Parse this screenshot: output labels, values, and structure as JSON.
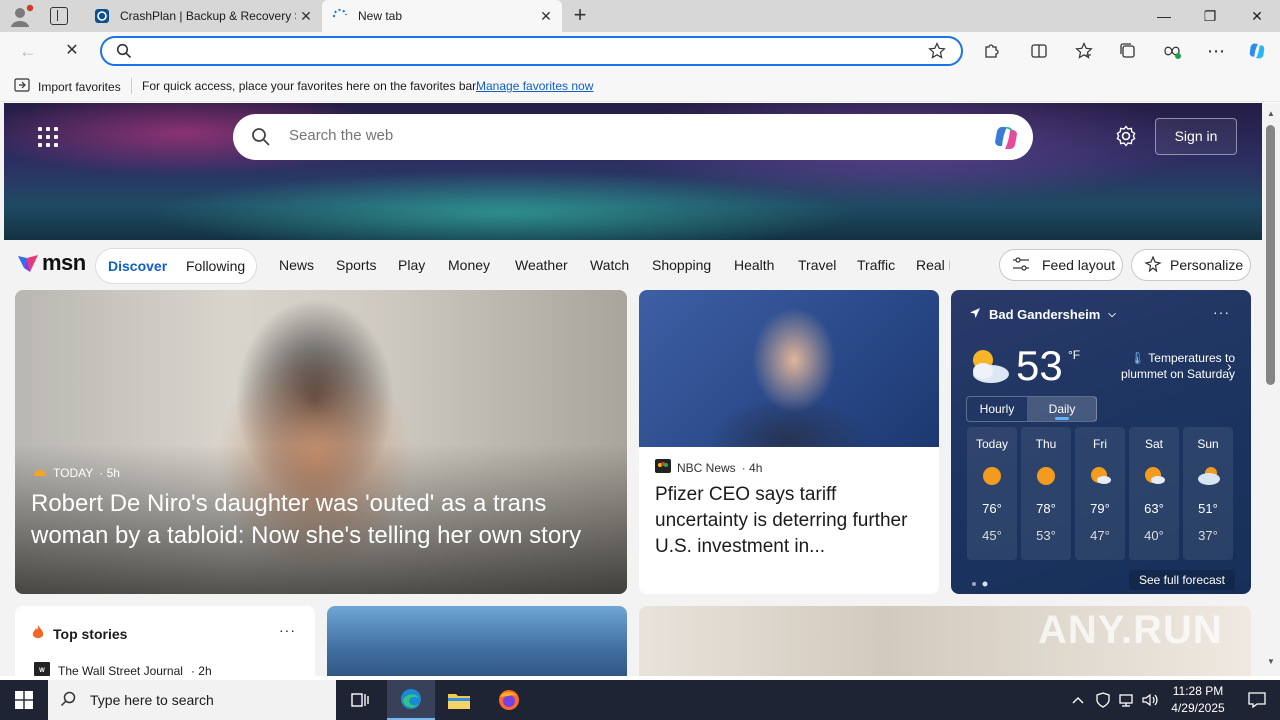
{
  "browser": {
    "tabs": [
      {
        "title": "CrashPlan | Backup & Recovery S",
        "active": false
      },
      {
        "title": "New tab",
        "active": true
      }
    ],
    "address_bar": {
      "value": "",
      "placeholder": ""
    },
    "favorites_bar": {
      "import_label": "Import favorites",
      "hint": "For quick access, place your favorites here on the favorites bar.",
      "manage_link": "Manage favorites now"
    }
  },
  "msn": {
    "search_placeholder": "Search the web",
    "sign_in": "Sign in",
    "logo_text": "msn",
    "pill": {
      "discover": "Discover",
      "following": "Following"
    },
    "nav": [
      "News",
      "Sports",
      "Play",
      "Money",
      "Weather",
      "Watch",
      "Shopping",
      "Health",
      "Travel",
      "Traffic",
      "Real E"
    ],
    "feed_layout": "Feed layout",
    "personalize": "Personalize"
  },
  "feature_story": {
    "source": "TODAY",
    "age": "· 5h",
    "headline": "Robert De Niro's daughter was 'outed' as a trans woman by a tabloid: Now she's telling her own story"
  },
  "story2": {
    "source": "NBC News",
    "age": "· 4h",
    "headline": "Pfizer CEO says tariff uncertainty is deterring further U.S. investment in..."
  },
  "weather": {
    "location": "Bad Gandersheim",
    "temperature": "53",
    "unit": "°F",
    "alert": "Temperatures to plummet on Saturday",
    "tabs": {
      "hourly": "Hourly",
      "daily": "Daily"
    },
    "days": [
      {
        "name": "Today",
        "high": "76°",
        "low": "45°",
        "icon": "sun-icon"
      },
      {
        "name": "Thu",
        "high": "78°",
        "low": "53°",
        "icon": "sun-icon"
      },
      {
        "name": "Fri",
        "high": "79°",
        "low": "47°",
        "icon": "partly-sunny-icon"
      },
      {
        "name": "Sat",
        "high": "63°",
        "low": "40°",
        "icon": "partly-sunny-icon"
      },
      {
        "name": "Sun",
        "high": "51°",
        "low": "37°",
        "icon": "cloudy-icon"
      }
    ],
    "full_forecast": "See full forecast"
  },
  "top_stories": {
    "title": "Top stories",
    "source": "The Wall Street Journal",
    "age": "· 2h"
  },
  "watermark": "ANY.RUN",
  "taskbar": {
    "search_placeholder": "Type here to search",
    "time": "11:28 PM",
    "date": "4/29/2025"
  },
  "colors": {
    "accent": "#1a73e8",
    "msn_blue": "#0f5fc4",
    "taskbar": "#1e2433"
  }
}
